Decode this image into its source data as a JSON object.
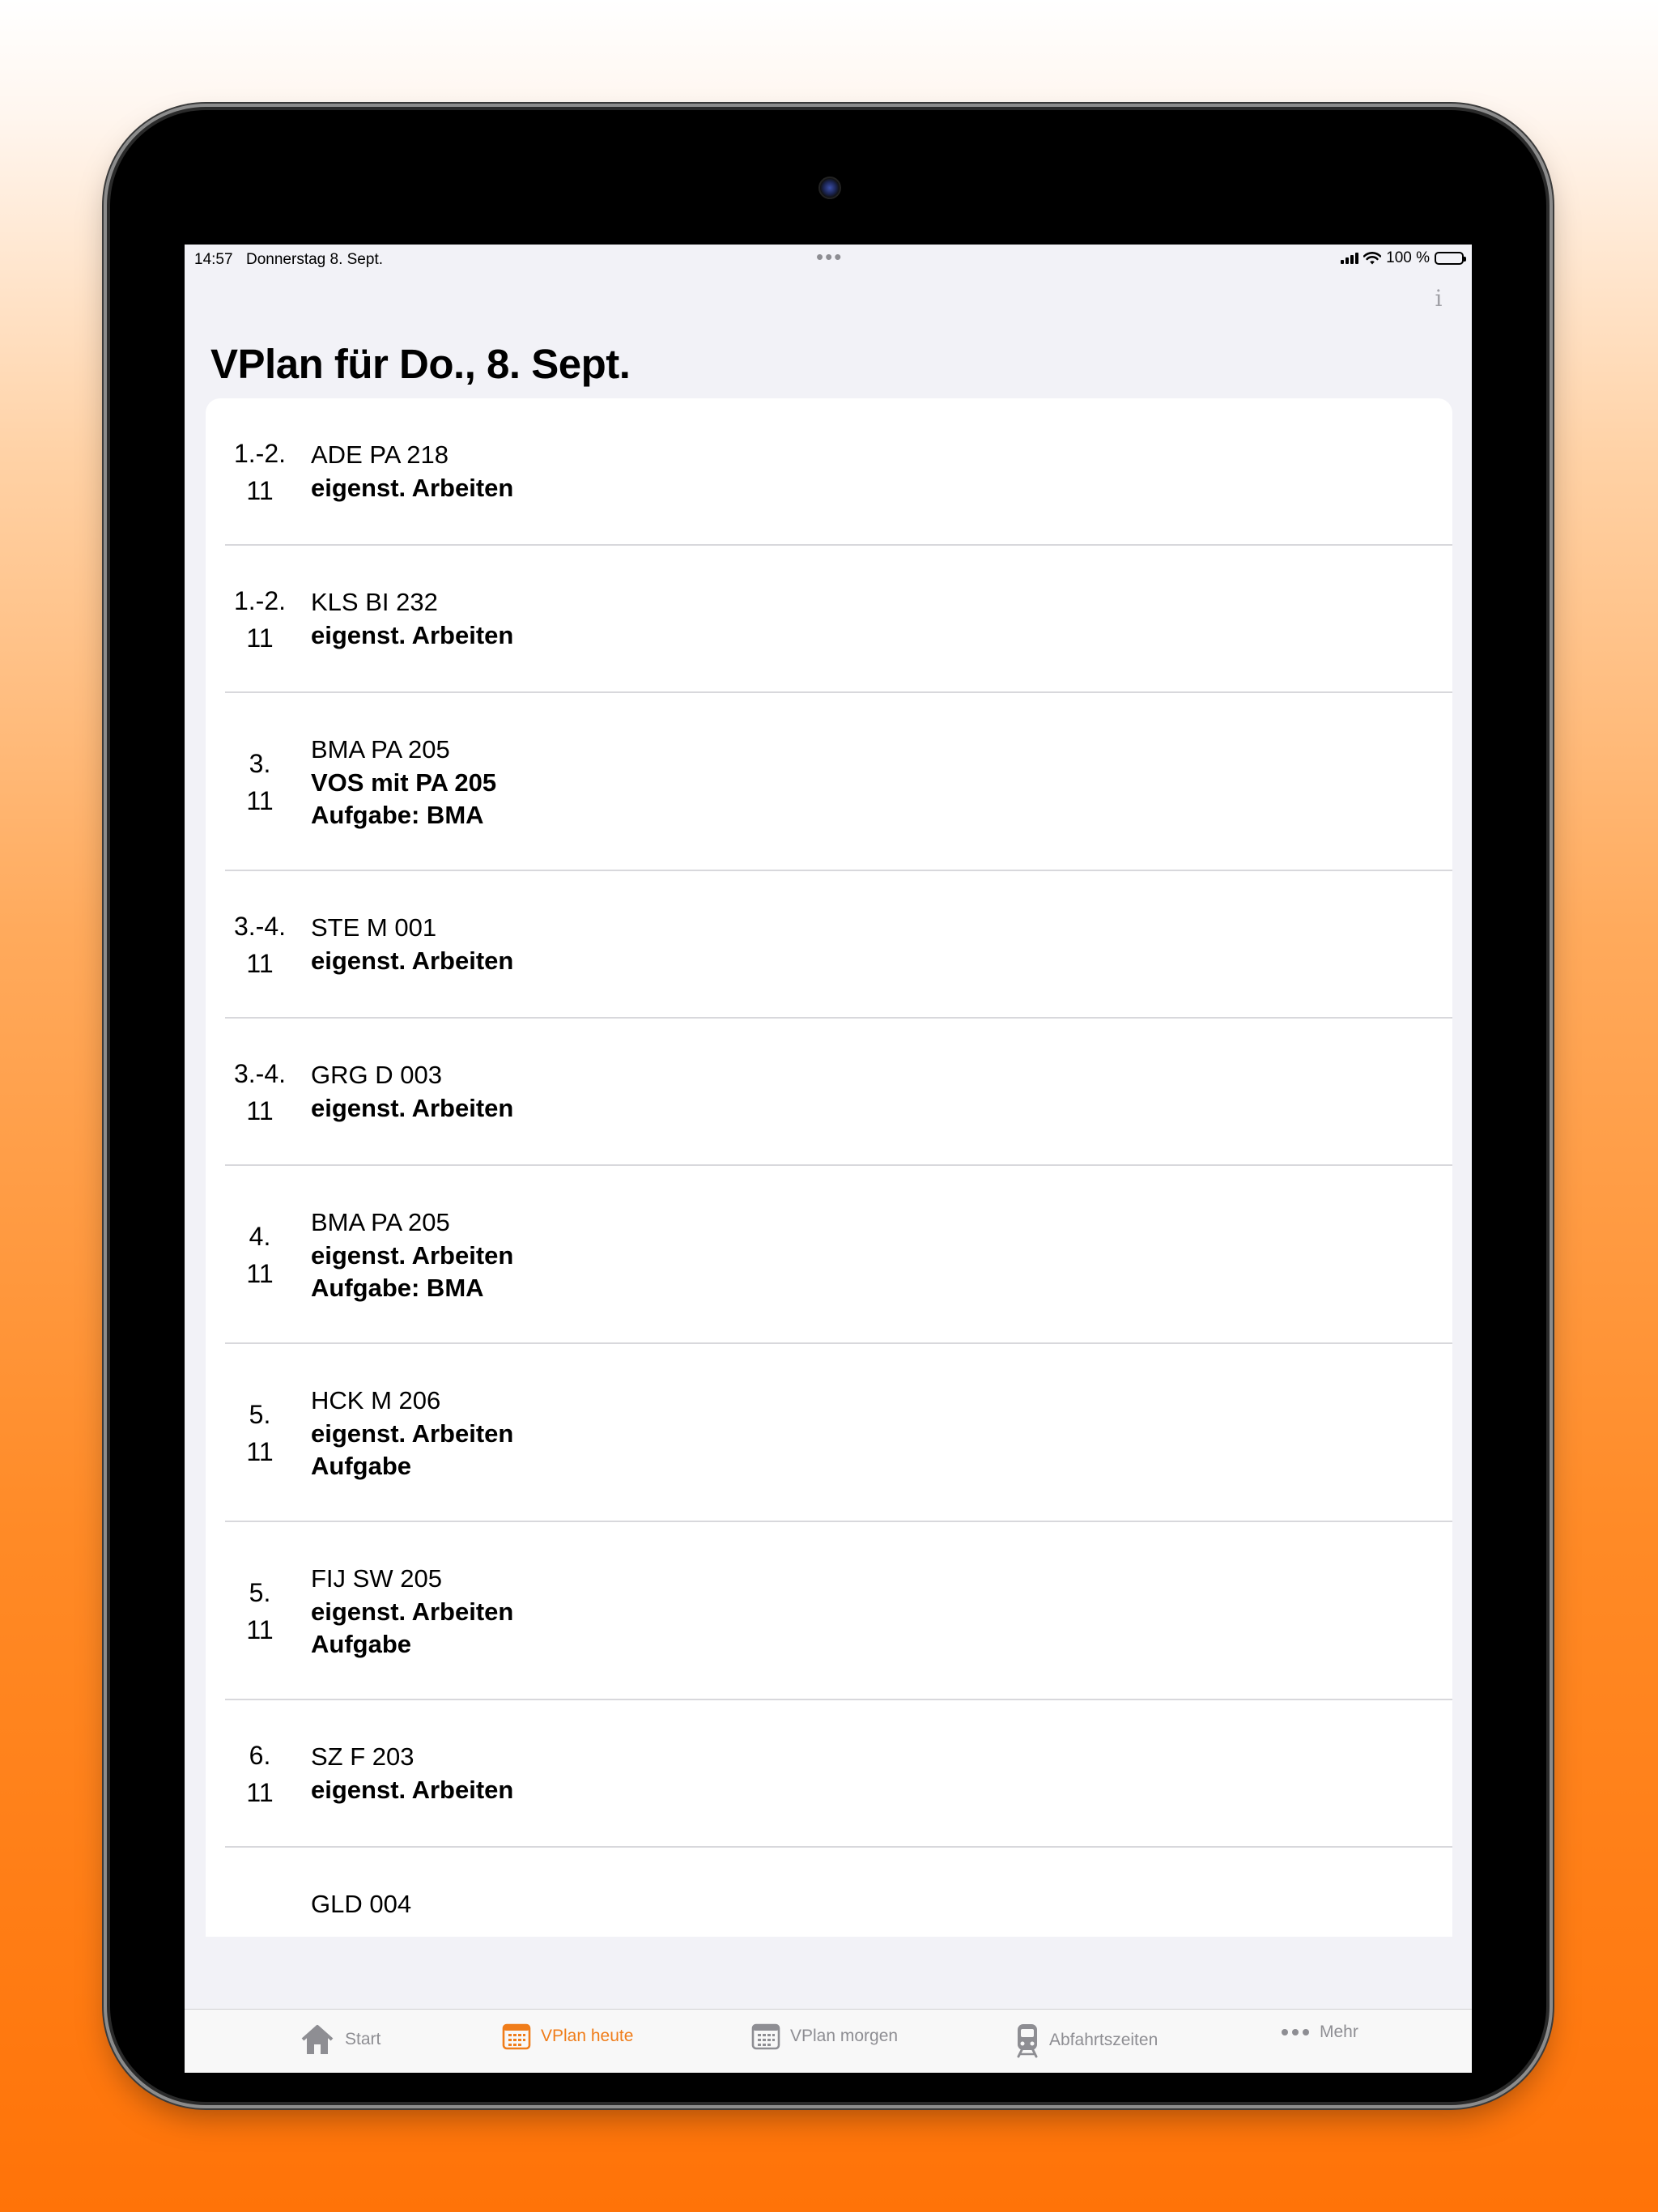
{
  "status_bar": {
    "time": "14:57",
    "date": "Donnerstag 8. Sept.",
    "battery": "100 %",
    "dots": "•••"
  },
  "nav": {
    "info_label": "i",
    "title": "VPlan für Do., 8. Sept."
  },
  "rows": [
    {
      "period": "1.-2.",
      "class": "11",
      "teacher": "ADE PA 218",
      "info": "eigenst. Arbeiten"
    },
    {
      "period": "1.-2.",
      "class": "11",
      "teacher": "KLS BI 232",
      "info": "eigenst. Arbeiten"
    },
    {
      "period": "3.",
      "class": "11",
      "teacher": "BMA PA 205",
      "info": "VOS mit PA 205",
      "task": "Aufgabe: BMA"
    },
    {
      "period": "3.-4.",
      "class": "11",
      "teacher": "STE M 001",
      "info": "eigenst. Arbeiten"
    },
    {
      "period": "3.-4.",
      "class": "11",
      "teacher": "GRG D 003",
      "info": "eigenst. Arbeiten"
    },
    {
      "period": "4.",
      "class": "11",
      "teacher": "BMA PA 205",
      "info": "eigenst. Arbeiten",
      "task": "Aufgabe: BMA"
    },
    {
      "period": "5.",
      "class": "11",
      "teacher": "HCK M 206",
      "info": "eigenst. Arbeiten",
      "task": "Aufgabe"
    },
    {
      "period": "5.",
      "class": "11",
      "teacher": "FIJ SW 205",
      "info": "eigenst. Arbeiten",
      "task": "Aufgabe"
    },
    {
      "period": "6.",
      "class": "11",
      "teacher": "SZ F 203",
      "info": "eigenst. Arbeiten"
    },
    {
      "period": "",
      "class": "",
      "teacher": "GLD 004",
      "info": ""
    }
  ],
  "tab_bar": {
    "tabs": [
      {
        "label": "Start",
        "icon": "house-icon",
        "active": false
      },
      {
        "label": "VPlan heute",
        "icon": "calendar-icon",
        "active": true
      },
      {
        "label": "VPlan morgen",
        "icon": "calendar-icon",
        "active": false
      },
      {
        "label": "Abfahrtszeiten",
        "icon": "tram-icon",
        "active": false
      },
      {
        "label": "Mehr",
        "icon": "more-icon",
        "active": false
      }
    ]
  },
  "colors": {
    "accent": "#f07d1a",
    "inactive": "#8e8e93",
    "background": "#f2f2f7"
  }
}
